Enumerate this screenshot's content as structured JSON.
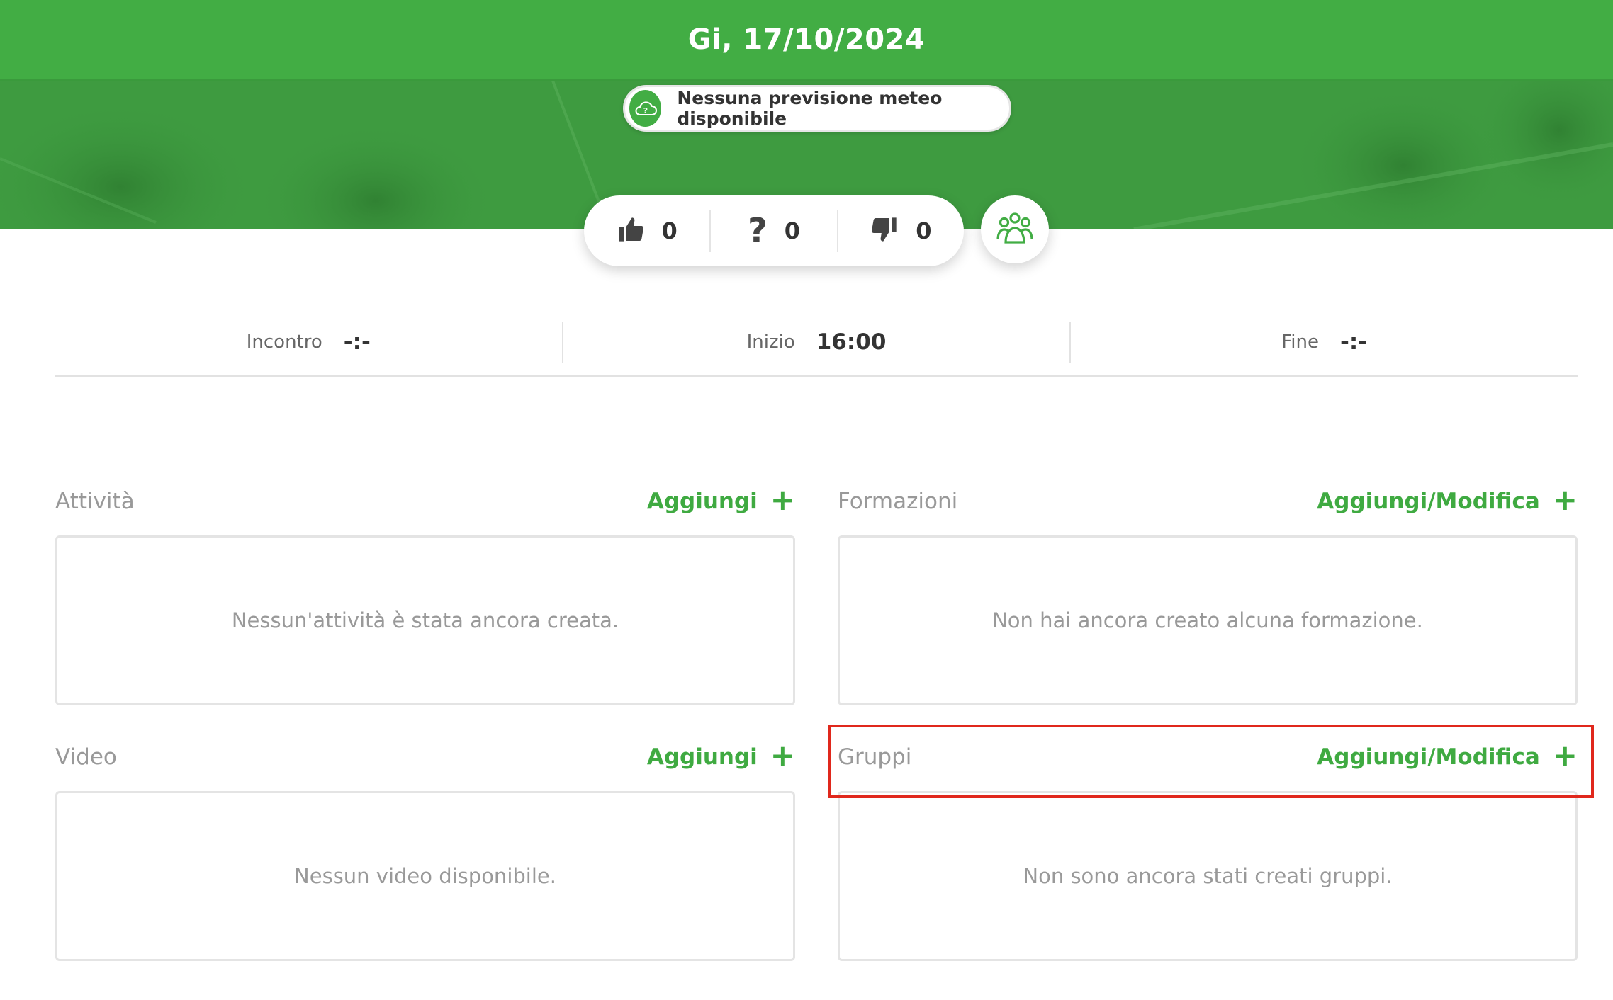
{
  "header": {
    "date": "Gi, 17/10/2024"
  },
  "weather": {
    "icon": "cloud-question-icon",
    "text": "Nessuna previsione meteo disponibile"
  },
  "votes": [
    {
      "icon": "thumbs-up-icon",
      "count": "0"
    },
    {
      "icon": "question-icon",
      "count": "0"
    },
    {
      "icon": "thumbs-down-icon",
      "count": "0"
    }
  ],
  "group_button": {
    "icon": "group-icon"
  },
  "times": [
    {
      "label": "Incontro",
      "value": "-:-"
    },
    {
      "label": "Inizio",
      "value": "16:00"
    },
    {
      "label": "Fine",
      "value": "-:-"
    }
  ],
  "sections": {
    "attivita": {
      "title": "Attività",
      "action": "Aggiungi",
      "empty": "Nessun'attività è stata ancora creata."
    },
    "formazioni": {
      "title": "Formazioni",
      "action": "Aggiungi/Modifica",
      "empty": "Non hai ancora creato alcuna formazione."
    },
    "video": {
      "title": "Video",
      "action": "Aggiungi",
      "empty": "Nessun video disponibile."
    },
    "gruppi": {
      "title": "Gruppi",
      "action": "Aggiungi/Modifica",
      "empty": "Non sono ancora stati creati gruppi."
    }
  },
  "colors": {
    "primary": "#42ad44",
    "highlight": "#e0281c"
  }
}
